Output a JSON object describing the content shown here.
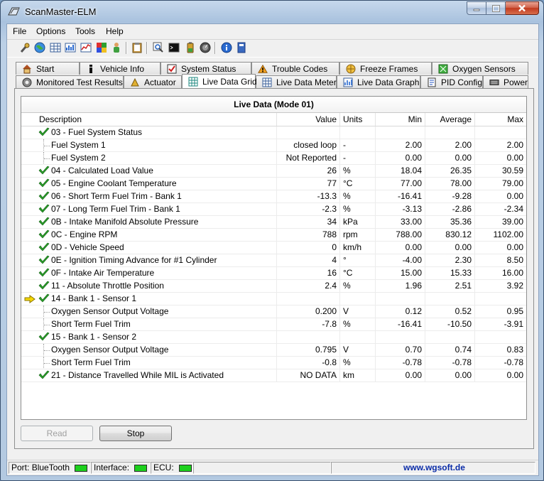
{
  "window": {
    "title": "ScanMaster-ELM"
  },
  "menu": [
    "File",
    "Options",
    "Tools",
    "Help"
  ],
  "toolbar": {
    "icons": [
      "wrench-connect-icon",
      "globe-icon",
      "grid-icon",
      "meter-icon",
      "graph-icon",
      "palette-icon",
      "person-icon",
      "clipboard-icon",
      "search-icon",
      "terminal-icon",
      "battery-icon",
      "dial-icon",
      "info-icon",
      "book-icon"
    ]
  },
  "tabs_top": [
    "Start",
    "Vehicle Info",
    "System Status",
    "Trouble Codes",
    "Freeze Frames",
    "Oxygen Sensors"
  ],
  "tabs_bottom": [
    "Monitored Test Results",
    "Actuator",
    "Live Data Grid",
    "Live Data Meter",
    "Live Data Graph",
    "PID Config",
    "Power"
  ],
  "active_tab": "Live Data Grid",
  "grid": {
    "title": "Live Data (Mode 01)",
    "headers": {
      "desc": "Description",
      "value": "Value",
      "units": "Units",
      "min": "Min",
      "avg": "Average",
      "max": "Max"
    },
    "rows": [
      {
        "desc": "03 - Fuel System Status",
        "value": "",
        "units": "",
        "min": "",
        "avg": "",
        "max": "",
        "check": true,
        "child": false,
        "arrow": false
      },
      {
        "desc": "Fuel System 1",
        "value": "closed loop",
        "units": "-",
        "min": "2.00",
        "avg": "2.00",
        "max": "2.00",
        "check": false,
        "child": true,
        "arrow": false
      },
      {
        "desc": "Fuel System 2",
        "value": "Not Reported",
        "units": "-",
        "min": "0.00",
        "avg": "0.00",
        "max": "0.00",
        "check": false,
        "child": true,
        "arrow": false
      },
      {
        "desc": "04 - Calculated Load Value",
        "value": "26",
        "units": "%",
        "min": "18.04",
        "avg": "26.35",
        "max": "30.59",
        "check": true,
        "child": false,
        "arrow": false
      },
      {
        "desc": "05 - Engine Coolant Temperature",
        "value": "77",
        "units": "°C",
        "min": "77.00",
        "avg": "78.00",
        "max": "79.00",
        "check": true,
        "child": false,
        "arrow": false
      },
      {
        "desc": "06 - Short Term Fuel Trim - Bank 1",
        "value": "-13.3",
        "units": "%",
        "min": "-16.41",
        "avg": "-9.28",
        "max": "0.00",
        "check": true,
        "child": false,
        "arrow": false
      },
      {
        "desc": "07 - Long Term Fuel Trim - Bank 1",
        "value": "-2.3",
        "units": "%",
        "min": "-3.13",
        "avg": "-2.86",
        "max": "-2.34",
        "check": true,
        "child": false,
        "arrow": false
      },
      {
        "desc": "0B - Intake Manifold Absolute Pressure",
        "value": "34",
        "units": "kPa",
        "min": "33.00",
        "avg": "35.36",
        "max": "39.00",
        "check": true,
        "child": false,
        "arrow": false
      },
      {
        "desc": "0C - Engine RPM",
        "value": "788",
        "units": "rpm",
        "min": "788.00",
        "avg": "830.12",
        "max": "1102.00",
        "check": true,
        "child": false,
        "arrow": false
      },
      {
        "desc": "0D - Vehicle Speed",
        "value": "0",
        "units": "km/h",
        "min": "0.00",
        "avg": "0.00",
        "max": "0.00",
        "check": true,
        "child": false,
        "arrow": false
      },
      {
        "desc": "0E - Ignition Timing Advance for #1 Cylinder",
        "value": "4",
        "units": "°",
        "min": "-4.00",
        "avg": "2.30",
        "max": "8.50",
        "check": true,
        "child": false,
        "arrow": false
      },
      {
        "desc": "0F - Intake Air Temperature",
        "value": "16",
        "units": "°C",
        "min": "15.00",
        "avg": "15.33",
        "max": "16.00",
        "check": true,
        "child": false,
        "arrow": false
      },
      {
        "desc": "11 - Absolute Throttle Position",
        "value": "2.4",
        "units": "%",
        "min": "1.96",
        "avg": "2.51",
        "max": "3.92",
        "check": true,
        "child": false,
        "arrow": false
      },
      {
        "desc": "14 - Bank 1 - Sensor 1",
        "value": "",
        "units": "",
        "min": "",
        "avg": "",
        "max": "",
        "check": true,
        "child": false,
        "arrow": true
      },
      {
        "desc": "Oxygen Sensor Output Voltage",
        "value": "0.200",
        "units": "V",
        "min": "0.12",
        "avg": "0.52",
        "max": "0.95",
        "check": false,
        "child": true,
        "arrow": false
      },
      {
        "desc": "Short Term Fuel Trim",
        "value": "-7.8",
        "units": "%",
        "min": "-16.41",
        "avg": "-10.50",
        "max": "-3.91",
        "check": false,
        "child": true,
        "arrow": false
      },
      {
        "desc": "15 - Bank 1 - Sensor 2",
        "value": "",
        "units": "",
        "min": "",
        "avg": "",
        "max": "",
        "check": true,
        "child": false,
        "arrow": false
      },
      {
        "desc": "Oxygen Sensor Output Voltage",
        "value": "0.795",
        "units": "V",
        "min": "0.70",
        "avg": "0.74",
        "max": "0.83",
        "check": false,
        "child": true,
        "arrow": false
      },
      {
        "desc": "Short Term Fuel Trim",
        "value": "-0.8",
        "units": "%",
        "min": "-0.78",
        "avg": "-0.78",
        "max": "-0.78",
        "check": false,
        "child": true,
        "arrow": false
      },
      {
        "desc": "21 - Distance Travelled While MIL is Activated",
        "value": "NO DATA",
        "units": "km",
        "min": "0.00",
        "avg": "0.00",
        "max": "0.00",
        "check": true,
        "child": false,
        "arrow": false
      }
    ]
  },
  "buttons": {
    "read": "Read",
    "stop": "Stop"
  },
  "status": {
    "port_label": "Port:",
    "port_value": "BlueTooth",
    "interface_label": "Interface:",
    "ecu_label": "ECU:",
    "url": "www.wgsoft.de",
    "led_color": "#1dd01d"
  }
}
